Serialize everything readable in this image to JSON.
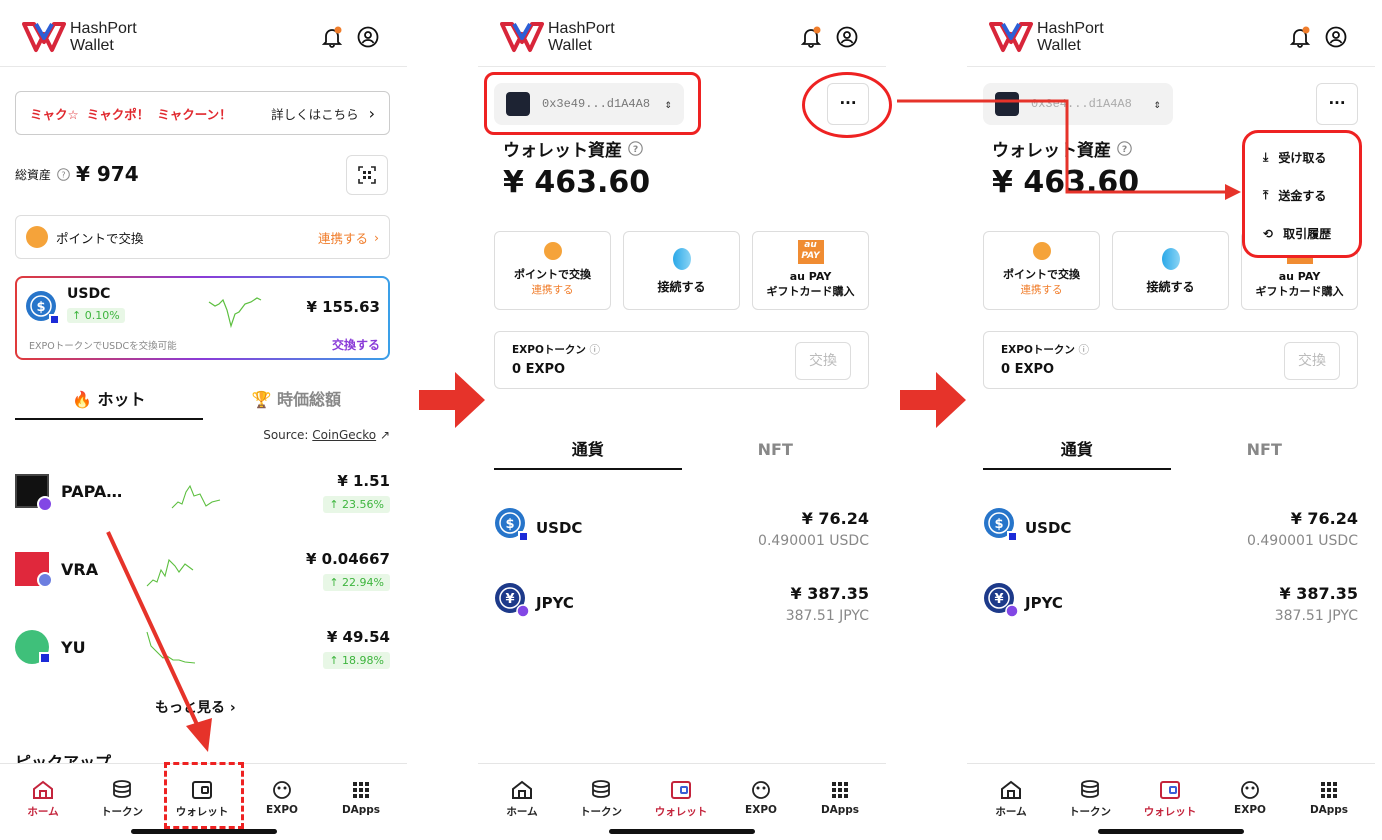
{
  "app": {
    "brand_line1": "HashPort",
    "brand_line2": "Wallet"
  },
  "screen1": {
    "banner": {
      "part1": "ミャク☆",
      "part2": "ミャクポ！",
      "part3": "ミャクーン！",
      "link": "詳しくはこちら"
    },
    "total": {
      "label": "総資産",
      "value": "¥ 974"
    },
    "points": {
      "label": "ポイントで交換",
      "link": "連携する"
    },
    "usdc_card": {
      "name": "USDC",
      "change": "0.10%",
      "value": "¥ 155.63",
      "note": "EXPOトークンでUSDCを交換可能",
      "link": "交換する"
    },
    "tabs": {
      "hot": "ホット",
      "marketcap": "時価総額"
    },
    "source": {
      "label": "Source:",
      "link": "CoinGecko"
    },
    "coins": [
      {
        "name": "PAPA…",
        "price": "¥  1.51",
        "change": "23.56%"
      },
      {
        "name": "VRA",
        "price": "¥  0.04667",
        "change": "22.94%"
      },
      {
        "name": "YU",
        "price": "¥  49.54",
        "change": "18.98%"
      }
    ],
    "more": "もっと見る",
    "pickup": "ピックアップ"
  },
  "wallet": {
    "address": "0x3e49...d1A4A8",
    "title": "ウォレット資産",
    "value": "¥ 463.60",
    "actions": [
      {
        "label": "ポイントで交換",
        "sub": "連携する"
      },
      {
        "label": "接続する",
        "sub": ""
      },
      {
        "label": "au PAY",
        "sub": "ギフトカード購入"
      }
    ],
    "aupay_logo": "au",
    "aupay_logo2": "PAY",
    "expo": {
      "label": "EXPOトークン",
      "amount": "0 EXPO",
      "button": "交換"
    },
    "tabs": {
      "currency": "通貨",
      "nft": "NFT"
    },
    "tokens": [
      {
        "name": "USDC",
        "price": "¥ 76.24",
        "amount": "0.490001 USDC"
      },
      {
        "name": "JPYC",
        "price": "¥ 387.35",
        "amount": "387.51 JPYC"
      }
    ],
    "address_partial": "0x3e4...d1A4A8"
  },
  "menu": {
    "receive": "受け取る",
    "send": "送金する",
    "history": "取引履歴"
  },
  "tabbar": {
    "home": "ホーム",
    "token": "トークン",
    "wallet": "ウォレット",
    "expo": "EXPO",
    "dapps": "DApps"
  },
  "colors": {
    "accent": "#c4243c",
    "annotation": "#e22222",
    "orange": "#f07d2b",
    "green": "#3eb53e"
  }
}
